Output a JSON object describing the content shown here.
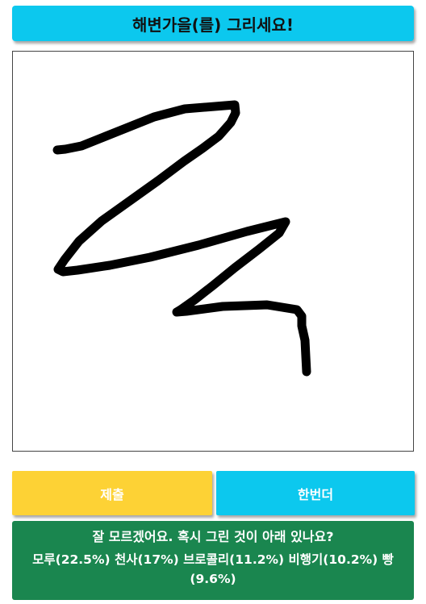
{
  "header": {
    "title": "해변가을(를) 그리세요!"
  },
  "canvas": {
    "stroke_color": "#000000",
    "background": "#ffffff"
  },
  "buttons": {
    "submit_label": "제출",
    "again_label": "한번더"
  },
  "result": {
    "question": "잘 모르겠어요. 혹시 그린 것이 아래 있나요?",
    "guesses": "모루(22.5%) 천사(17%) 브로콜리(11.2%) 비행기(10.2%) 빵(9.6%)"
  },
  "colors": {
    "title_bg": "#0cc8ee",
    "submit_bg": "#fdd235",
    "again_bg": "#0cc8ee",
    "result_bg": "#1a864f"
  }
}
